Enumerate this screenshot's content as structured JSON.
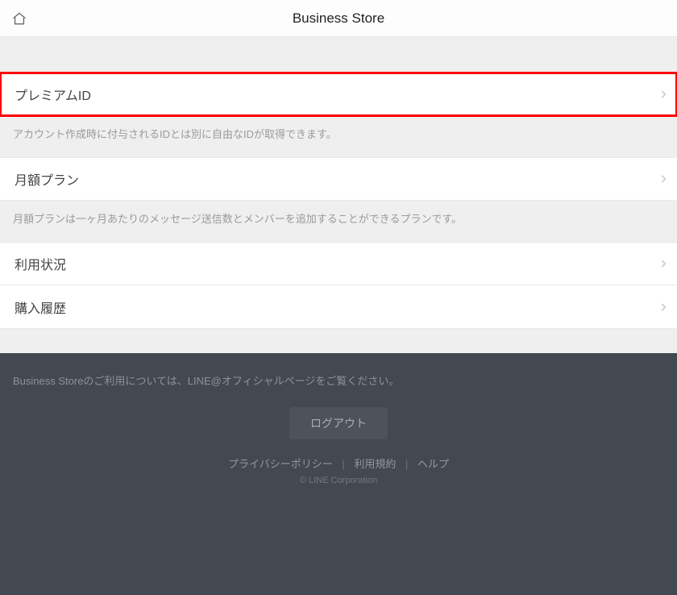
{
  "header": {
    "title": "Business Store"
  },
  "sections": [
    {
      "label": "プレミアムID",
      "desc": "アカウント作成時に付与されるIDとは別に自由なIDが取得できます。"
    },
    {
      "label": "月額プラン",
      "desc": "月額プランは一ヶ月あたりのメッセージ送信数とメンバーを追加することができるプランです。"
    }
  ],
  "list": [
    {
      "label": "利用状況"
    },
    {
      "label": "購入履歴"
    }
  ],
  "footer": {
    "note": "Business Storeのご利用については、LINE@オフィシャルページをご覧ください。",
    "logout": "ログアウト",
    "links": {
      "privacy": "プライバシーポリシー",
      "terms": "利用規約",
      "help": "ヘルプ"
    },
    "copyright": "© LINE Corporation"
  }
}
